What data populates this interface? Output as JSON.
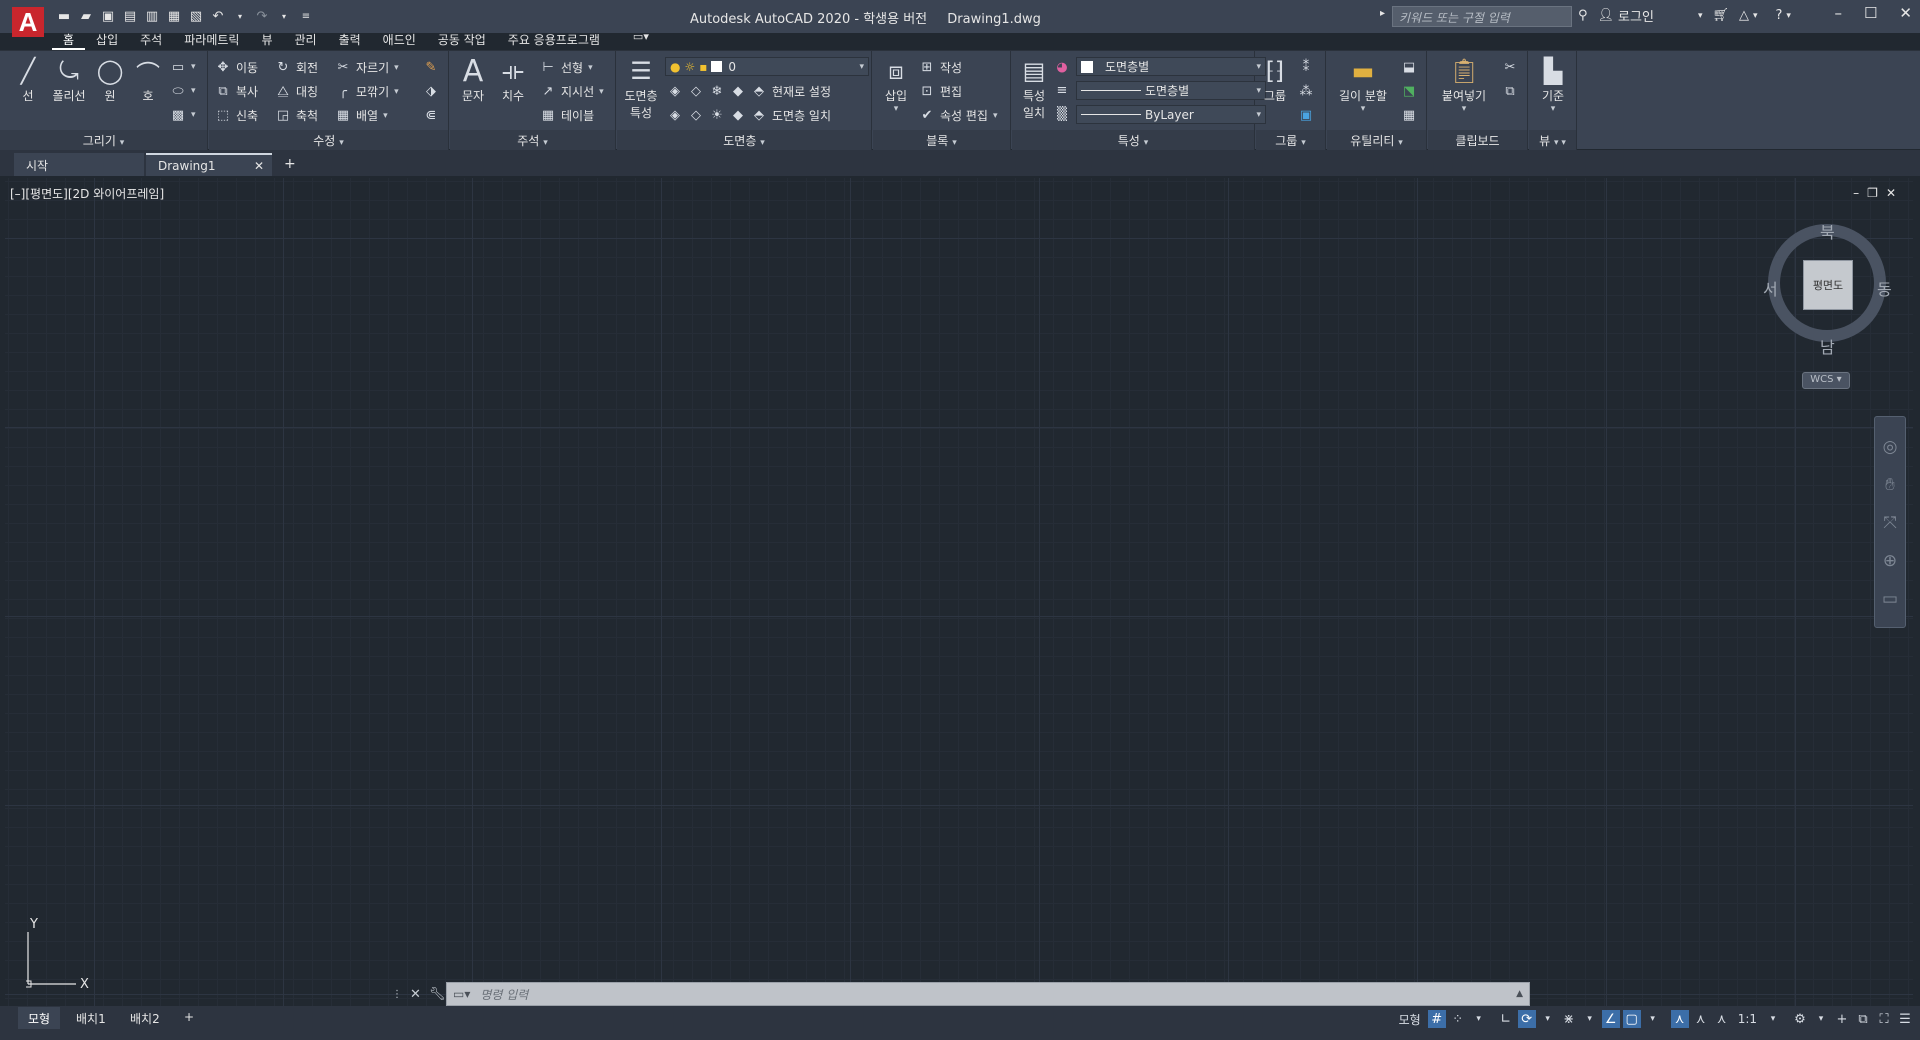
{
  "app": {
    "logo_letter": "A",
    "title": "Autodesk AutoCAD 2020 - 학생용 버전",
    "filename": "Drawing1.dwg",
    "search_placeholder": "키워드 또는 구절 입력",
    "login_label": "로그인"
  },
  "ribbon_tabs": [
    "홈",
    "삽입",
    "주석",
    "파라메트릭",
    "뷰",
    "관리",
    "출력",
    "애드인",
    "공동 작업",
    "주요 응용프로그램"
  ],
  "panels": {
    "draw": {
      "title": "그리기",
      "line": "선",
      "polyline": "폴리선",
      "circle": "원",
      "arc": "호"
    },
    "modify": {
      "title": "수정",
      "move": "이동",
      "rotate": "회전",
      "trim": "자르기",
      "copy": "복사",
      "mirror": "대칭",
      "fillet": "모깎기",
      "stretch": "신축",
      "scale": "축척",
      "array": "배열"
    },
    "annotation": {
      "title": "주석",
      "text": "문자",
      "dimension": "치수",
      "linear": "선형",
      "leader": "지시선",
      "table": "테이블"
    },
    "layers": {
      "title": "도면층",
      "properties_line1": "도면층",
      "properties_line2": "특성",
      "current_layer": "0",
      "set_current": "현재로 설정",
      "match_layer": "도면층 일치"
    },
    "block": {
      "title": "블록",
      "insert": "삽입",
      "create": "작성",
      "edit": "편집",
      "edit_attributes": "속성 편집"
    },
    "properties": {
      "title": "특성",
      "match_line1": "특성",
      "match_line2": "일치",
      "color": "도면층별",
      "linetype": "도면층별",
      "lineweight": "ByLayer"
    },
    "groups": {
      "title": "그룹",
      "group": "그룹"
    },
    "utilities": {
      "title": "유틸리티",
      "measure": "길이 분할"
    },
    "clipboard": {
      "title": "클립보드",
      "paste": "붙여넣기"
    },
    "view": {
      "title": "뷰",
      "base": "기준"
    }
  },
  "file_tabs": {
    "start": "시작",
    "drawing": "Drawing1"
  },
  "viewport": {
    "label": "[–][평면도][2D 와이어프레임]"
  },
  "viewcube": {
    "north": "북",
    "south": "남",
    "east": "동",
    "west": "서",
    "face": "평면도",
    "wcs": "WCS"
  },
  "ucs": {
    "x": "X",
    "y": "Y"
  },
  "command_line": {
    "placeholder": "명령 입력"
  },
  "layout_tabs": [
    "모형",
    "배치1",
    "배치2"
  ],
  "status": {
    "model": "모형",
    "scale": "1:1"
  },
  "colors": {
    "background": "#212830",
    "ribbon": "#3b4453",
    "accent": "#3c6ea8",
    "logo": "#c9262d"
  }
}
